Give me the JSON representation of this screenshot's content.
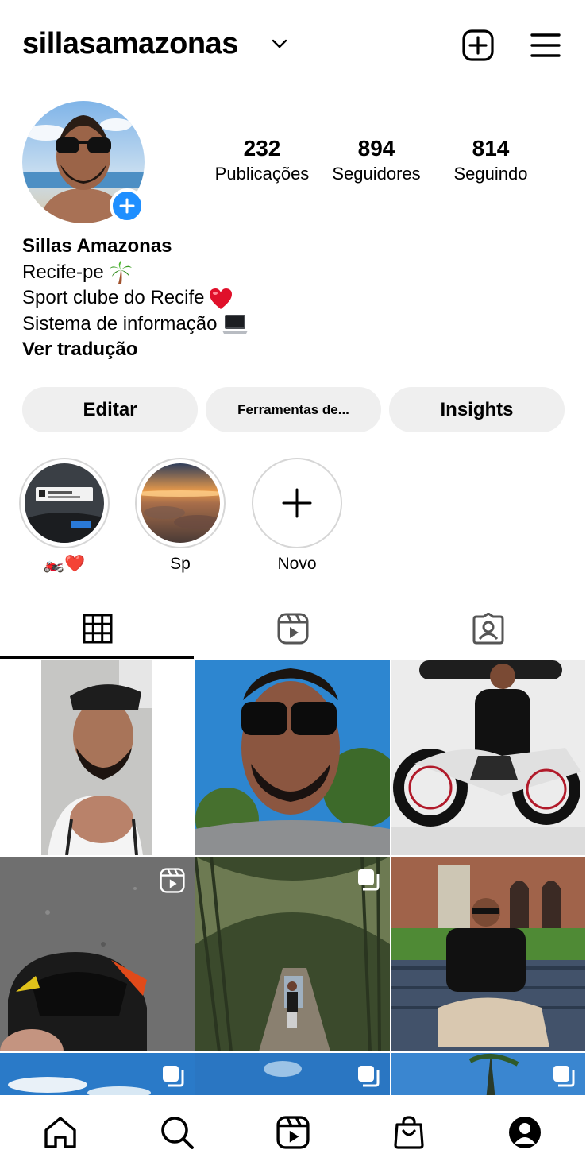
{
  "header": {
    "username": "sillasamazonas"
  },
  "stats": [
    {
      "num": "232",
      "label": "Publicações"
    },
    {
      "num": "894",
      "label": "Seguidores"
    },
    {
      "num": "814",
      "label": "Seguindo"
    }
  ],
  "bio": {
    "name": "Sillas Amazonas",
    "line1": "Recife-pe",
    "line2": "Sport clube do Recife",
    "line3": "Sistema de informação",
    "translate": "Ver tradução"
  },
  "buttons": {
    "edit": "Editar",
    "tools": "Ferramentas de...",
    "insights": "Insights"
  },
  "highlights": [
    {
      "label": "🏍️❤️"
    },
    {
      "label": "Sp"
    },
    {
      "label": "Novo"
    }
  ],
  "colors": {
    "accent": "#1f8fff",
    "button_bg": "#efefef",
    "divider": "#d6d6d6"
  },
  "icons": {
    "header": [
      "chevron-down-icon",
      "new-post-icon",
      "menu-icon"
    ],
    "tabs": [
      "grid-icon",
      "reels-icon",
      "tagged-icon"
    ],
    "nav": [
      "home-icon",
      "search-icon",
      "reels-icon",
      "shop-icon",
      "profile-icon"
    ]
  }
}
